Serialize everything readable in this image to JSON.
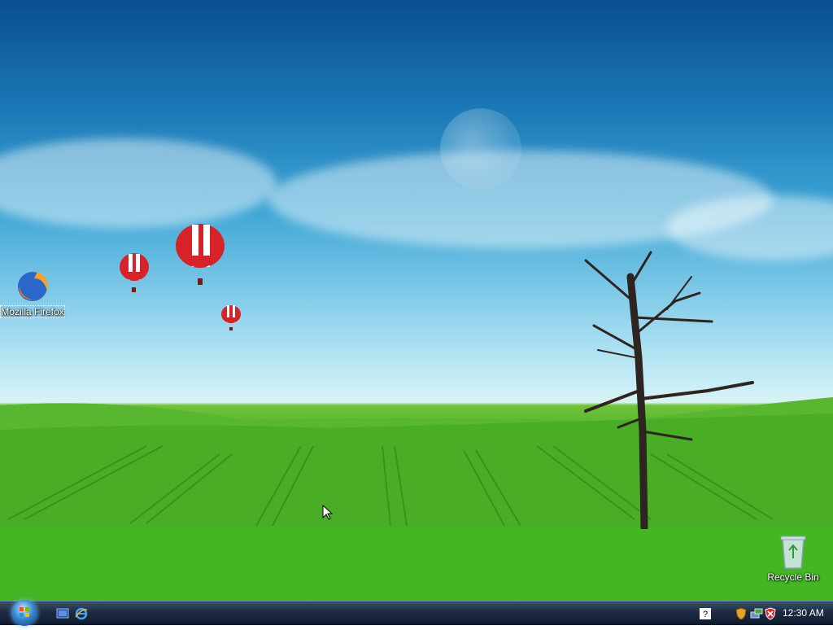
{
  "desktop": {
    "icons": [
      {
        "label": "Mozilla Firefox",
        "icon": "firefox-icon"
      },
      {
        "label": "Recycle Bin",
        "icon": "recycle-bin-icon"
      }
    ]
  },
  "taskbar": {
    "start_button": "start-orb-icon",
    "quick_launch": [
      "show-desktop-icon",
      "internet-explorer-icon"
    ],
    "tray_icons": [
      "help-icon",
      "security-shield-icon",
      "network-icon",
      "security-alert-icon"
    ],
    "clock": "12:30 AM"
  }
}
